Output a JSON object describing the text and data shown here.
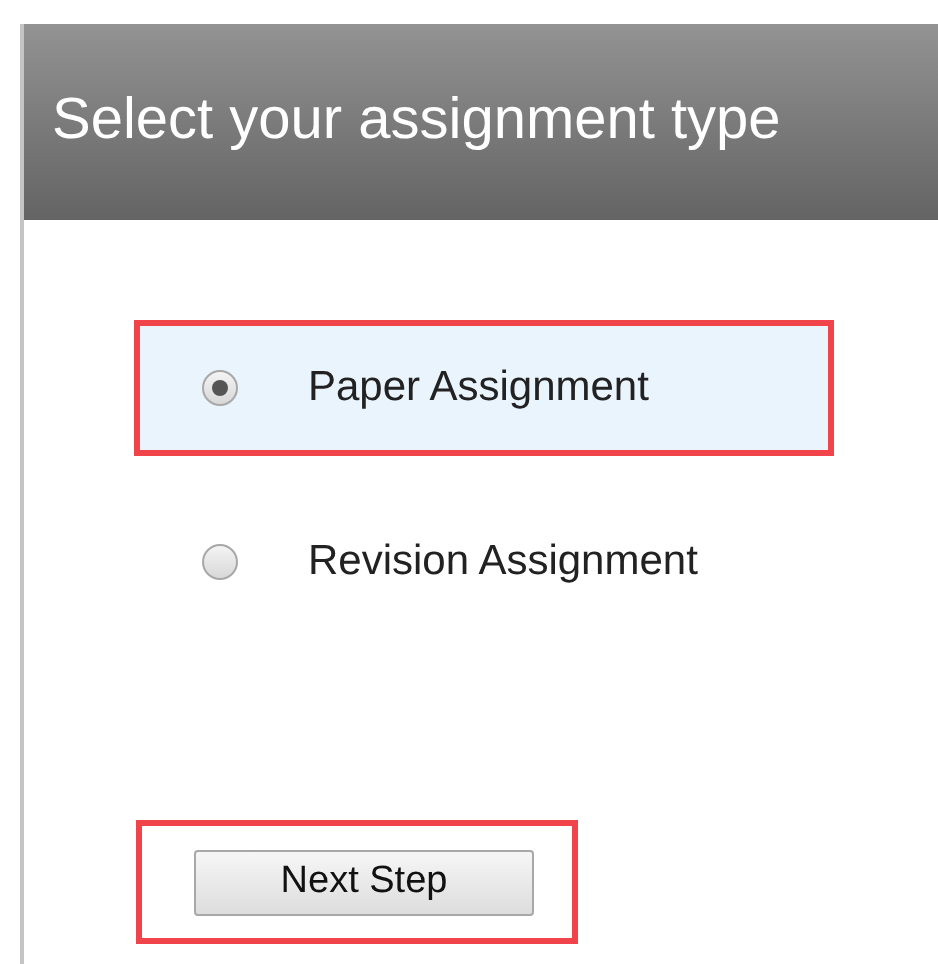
{
  "header": {
    "title": "Select your assignment type"
  },
  "options": [
    {
      "label": "Paper Assignment",
      "selected": true,
      "highlighted": true
    },
    {
      "label": "Revision Assignment",
      "selected": false,
      "highlighted": false
    }
  ],
  "button": {
    "label": "Next Step",
    "highlighted": true
  }
}
